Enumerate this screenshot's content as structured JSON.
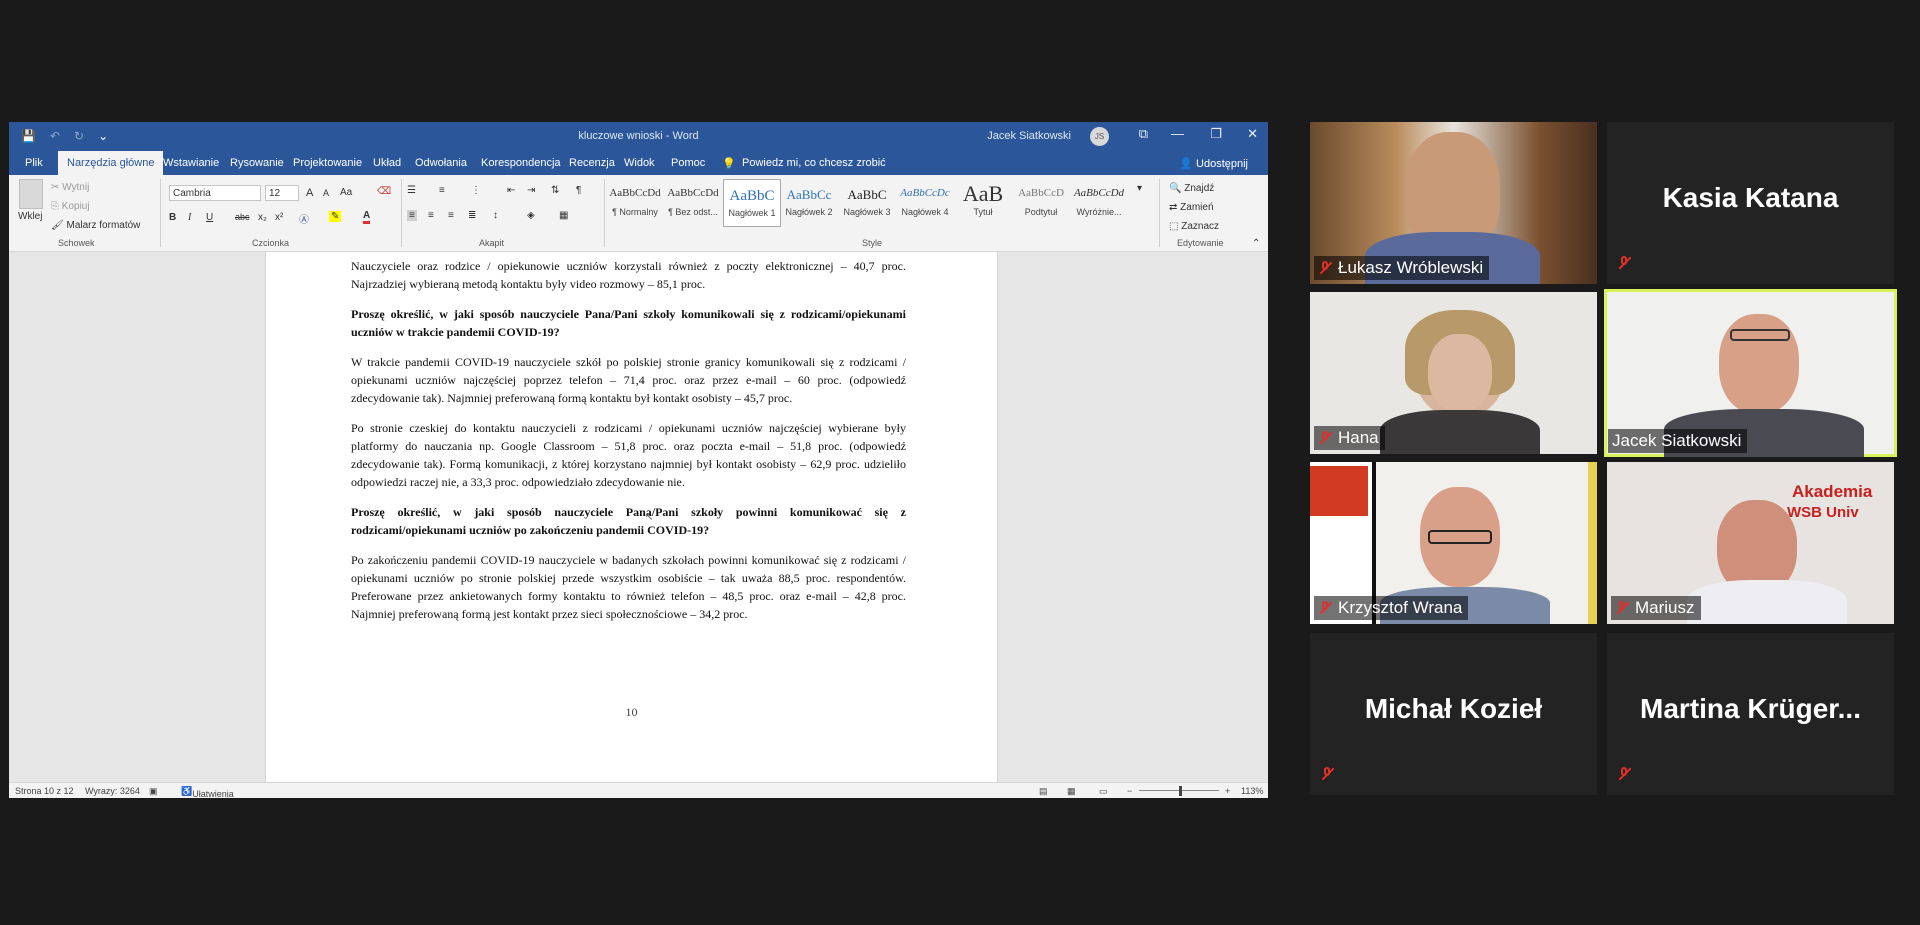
{
  "word": {
    "title": "kluczowe wnioski - Word",
    "user": "Jacek Siatkowski",
    "user_initials": "JS",
    "qat": {
      "save": "💾",
      "undo": "↶",
      "redo": "↻",
      "more": "⌄"
    },
    "window_controls": {
      "ribbon_options": "⧉",
      "minimize": "—",
      "restore": "❐",
      "close": "✕"
    },
    "tabs": [
      "Plik",
      "Narzędzia główne",
      "Wstawianie",
      "Rysowanie",
      "Projektowanie",
      "Układ",
      "Odwołania",
      "Korespondencja",
      "Recenzja",
      "Widok",
      "Pomoc"
    ],
    "tell_me": "Powiedz mi, co chcesz zrobić",
    "share": "Udostępnij",
    "ribbon": {
      "clipboard": {
        "paste": "Wklej",
        "cut": "Wytnij",
        "copy": "Kopiuj",
        "painter": "Malarz formatów",
        "label": "Schowek"
      },
      "font": {
        "name": "Cambria",
        "size": "12",
        "label": "Czcionka",
        "grow": "A",
        "shrink": "A",
        "case": "Aa",
        "bold": "B",
        "italic": "I",
        "underline": "U",
        "strike": "abc",
        "sub": "x₂",
        "sup": "x²"
      },
      "paragraph": {
        "label": "Akapit"
      },
      "styles": {
        "label": "Style",
        "items": [
          {
            "sample": "AaBbCcDd",
            "name": "¶ Normalny"
          },
          {
            "sample": "AaBbCcDd",
            "name": "¶ Bez odst..."
          },
          {
            "sample": "AaBbC",
            "name": "Nagłówek 1"
          },
          {
            "sample": "AaBbCc",
            "name": "Nagłówek 2"
          },
          {
            "sample": "AaBbC",
            "name": "Nagłówek 3"
          },
          {
            "sample": "AaBbCcDc",
            "name": "Nagłówek 4"
          },
          {
            "sample": "AaB",
            "name": "Tytuł"
          },
          {
            "sample": "AaBbCcD",
            "name": "Podtytuł"
          },
          {
            "sample": "AaBbCcDd",
            "name": "Wyróżnie..."
          }
        ]
      },
      "editing": {
        "find": "Znajdź",
        "replace": "Zamień",
        "select": "Zaznacz",
        "label": "Edytowanie"
      }
    },
    "document": {
      "p1": "Nauczyciele oraz rodzice / opiekunowie uczniów korzystali również z poczty elektronicznej – 40,7 proc. Najrzadziej wybieraną metodą kontaktu były video rozmowy – 85,1 proc.",
      "h1": "Proszę określić, w jaki sposób nauczyciele Pana/Pani szkoły komunikowali się z rodzicami/opiekunami uczniów w trakcie pandemii COVID-19?",
      "p2": "W trakcie pandemii COVID-19 nauczyciele szkół po polskiej stronie granicy komunikowali się z rodzicami / opiekunami uczniów najczęściej poprzez telefon – 71,4 proc. oraz przez e-mail – 60 proc. (odpowiedź zdecydowanie tak). Najmniej preferowaną formą kontaktu był kontakt osobisty – 45,7 proc.",
      "p3": "Po stronie czeskiej do kontaktu nauczycieli z rodzicami / opiekunami uczniów najczęściej wybierane były platformy do nauczania np. Google Classroom – 51,8 proc. oraz poczta e-mail – 51,8 proc. (odpowiedź zdecydowanie tak). Formą komunikacji, z której korzystano najmniej był kontakt osobisty – 62,9 proc. udzieliło odpowiedzi raczej nie, a 33,3 proc. odpowiedziało zdecydowanie nie.",
      "h2": "Proszę określić, w jaki sposób nauczyciele Pana/Pani szkoły powinni komunikować się z rodzicami/opiekunami uczniów po zakończeniu pandemii COVID-19?",
      "p4": "Po zakończeniu pandemii COVID-19 nauczyciele w badanych szkołach powinni komunikować się z rodzicami / opiekunami uczniów po stronie polskiej przede wszystkim osobiście – tak uważa 88,5 proc. respondentów. Preferowane przez ankietowanych formy kontaktu to również telefon – 48,5 proc. oraz e-mail – 42,8 proc. Najmniej preferowaną formą jest kontakt przez sieci społecznościowe – 34,2 proc.",
      "page_number": "10"
    },
    "status": {
      "page": "Strona 10 z 12",
      "words": "Wyrazy: 3264",
      "accessibility": "Ułatwienia dostępu: zbadaj",
      "zoom": "113%"
    }
  },
  "participants": [
    {
      "name": "Łukasz Wróblewski",
      "video": true,
      "muted": true
    },
    {
      "name": "Kasia Katana",
      "video": false,
      "muted": true
    },
    {
      "name": "Hana",
      "video": true,
      "muted": true
    },
    {
      "name": "Jacek Siatkowski",
      "video": true,
      "muted": false,
      "active": true
    },
    {
      "name": "Krzysztof Wrana",
      "video": true,
      "muted": true
    },
    {
      "name": "Mariusz",
      "video": true,
      "muted": true
    },
    {
      "name": "Michał Kozieł",
      "video": false,
      "muted": true
    },
    {
      "name": "Martina  Krüger...",
      "video": false,
      "muted": true
    }
  ],
  "colors": {
    "word_blue": "#2b579a",
    "active_speaker": "#d8f05a",
    "muted_red": "#e0302a"
  },
  "backdrop_text": {
    "banner": "Akademia",
    "banner2": "WSB Univ"
  }
}
